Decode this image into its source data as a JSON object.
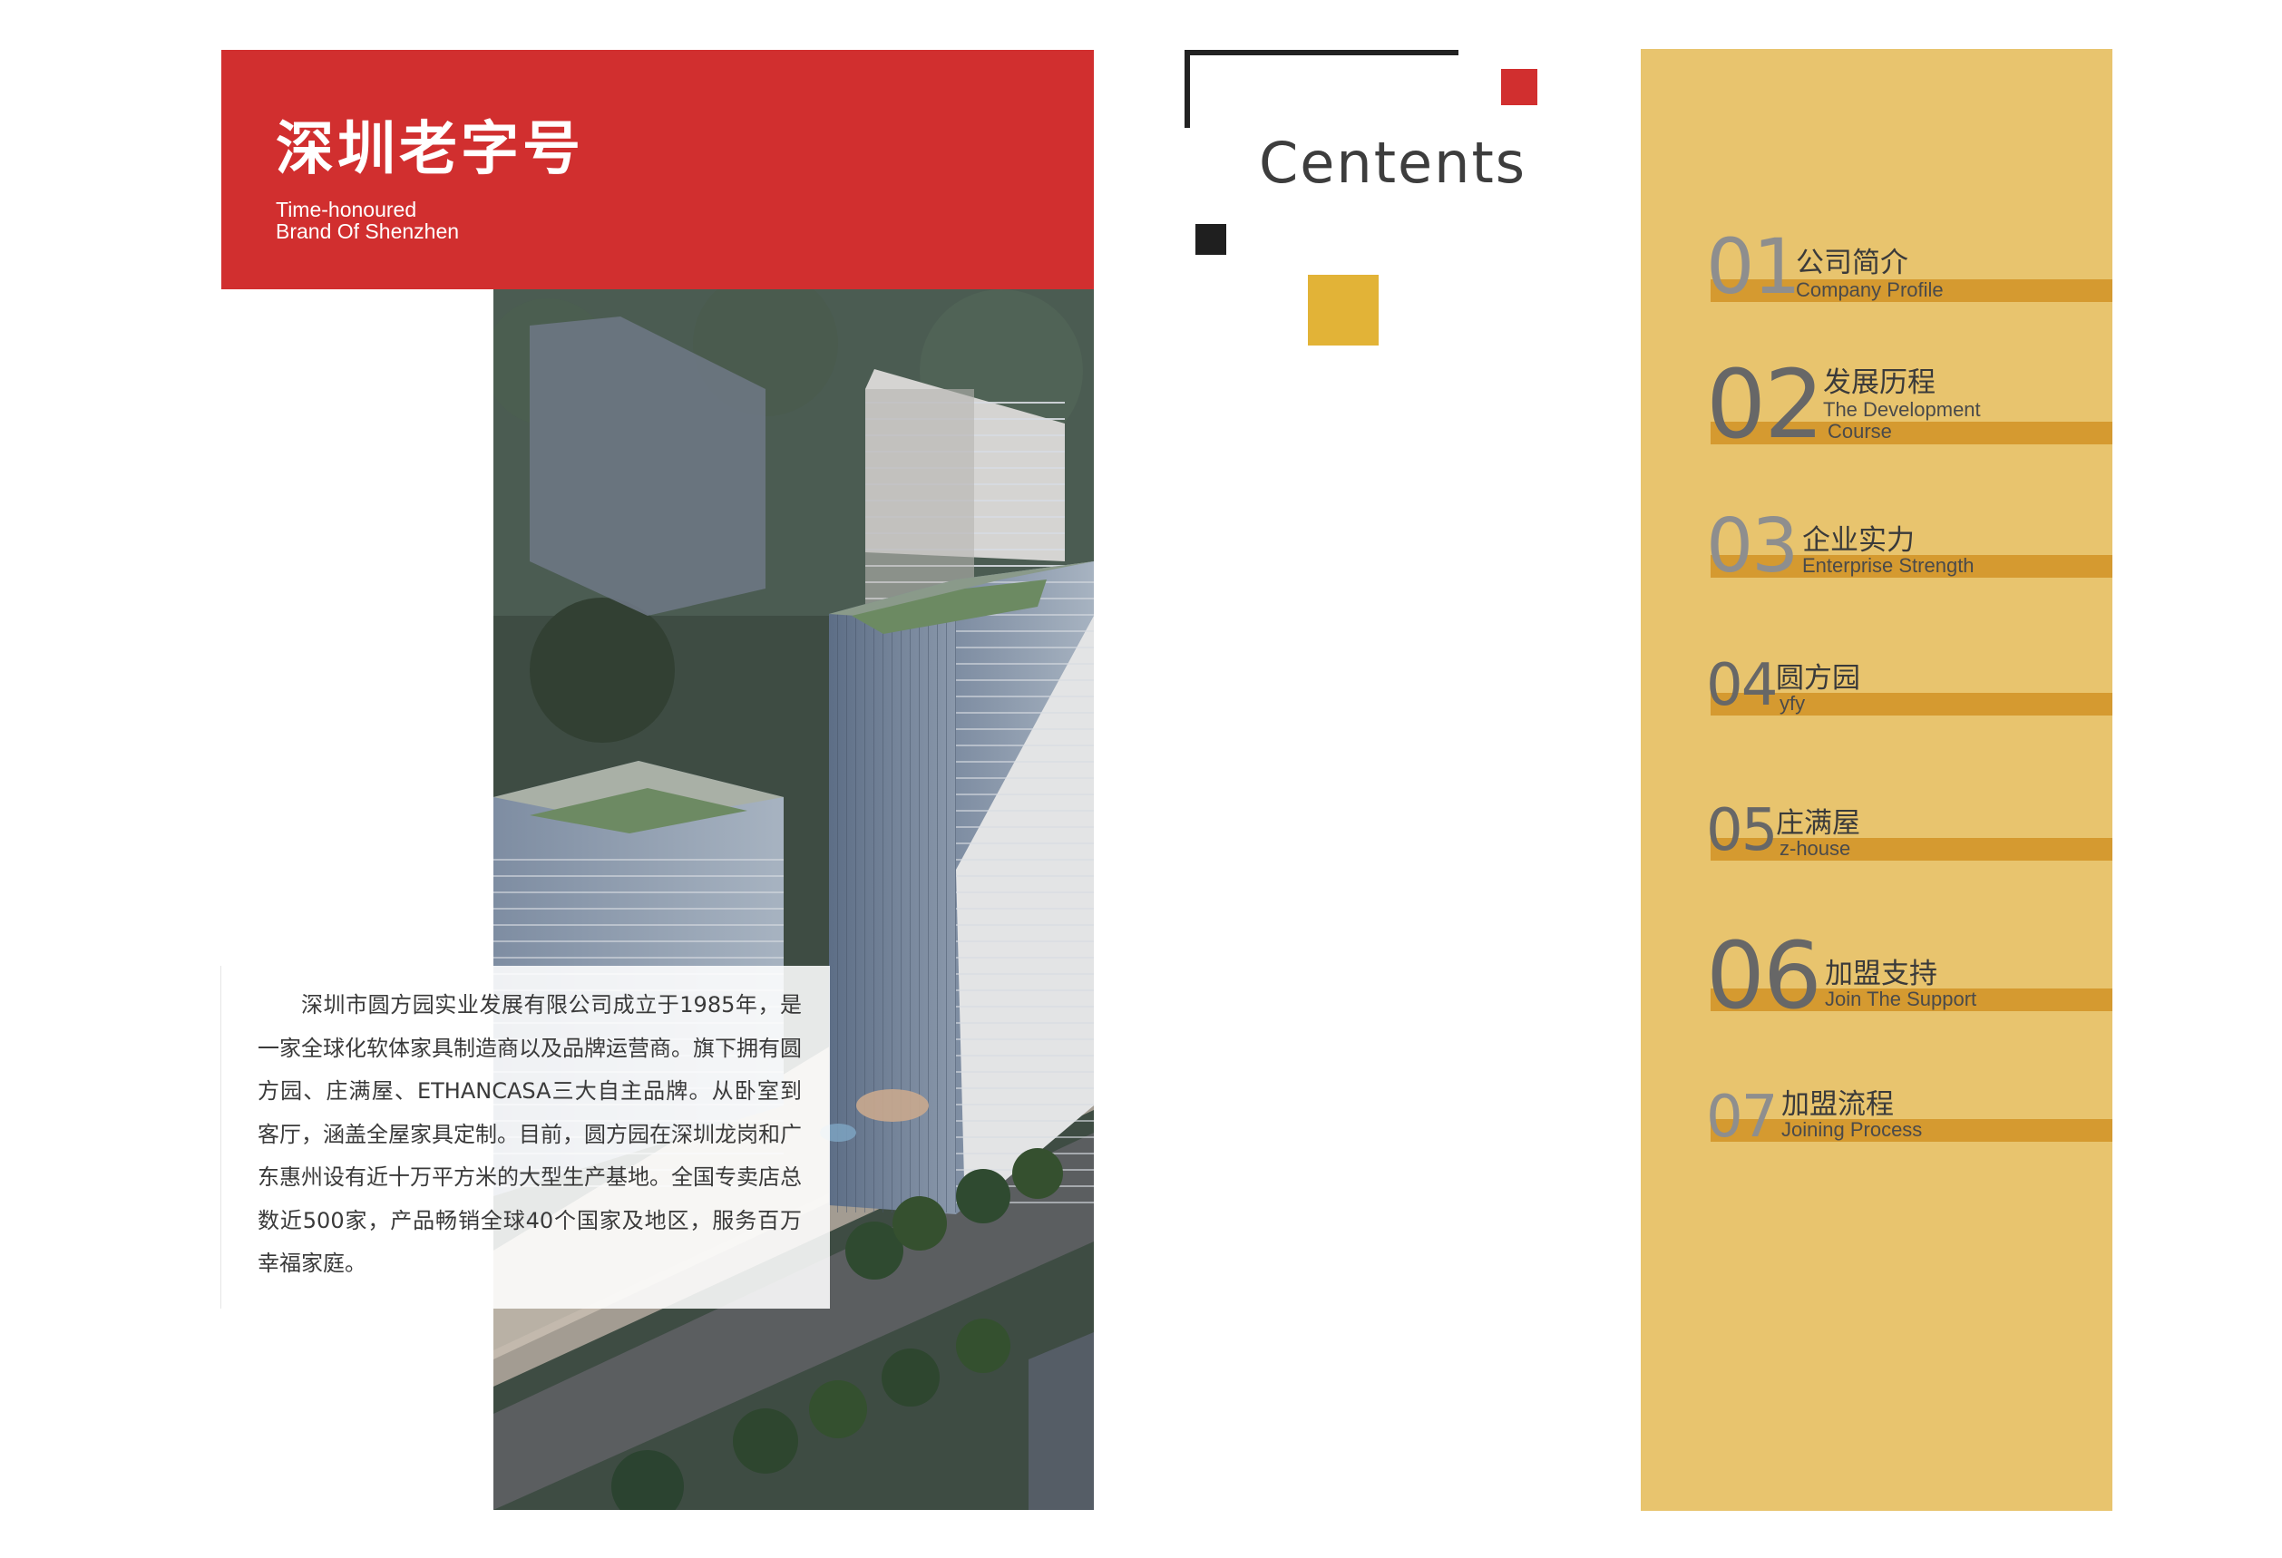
{
  "banner": {
    "title": "深圳老字号",
    "subtitle_line1": "Time-honoured",
    "subtitle_line2": "Brand Of Shenzhen"
  },
  "intro": {
    "text": "深圳市圆方园实业发展有限公司成立于1985年，是一家全球化软体家具制造商以及品牌运营商。旗下拥有圆方园、庄满屋、ETHANCASA三大自主品牌。从卧室到客厅，涵盖全屋家具定制。目前，圆方园在深圳龙岗和广东惠州设有近十万平方米的大型生产基地。全国专卖店总数近500家，产品畅销全球40个国家及地区，服务百万幸福家庭。"
  },
  "contents": {
    "title": "Centents"
  },
  "toc": {
    "items": [
      {
        "num": "01",
        "cn": "公司简介",
        "en": "Company Profile"
      },
      {
        "num": "02",
        "cn": "发展历程",
        "en": "The Development",
        "en2": "Course"
      },
      {
        "num": "03",
        "cn": "企业实力",
        "en": "Enterprise Strength"
      },
      {
        "num": "04",
        "cn": "圆方园",
        "en": "yfy"
      },
      {
        "num": "05",
        "cn": "庄满屋",
        "en": "z-house"
      },
      {
        "num": "06",
        "cn": "加盟支持",
        "en": "Join The Support"
      },
      {
        "num": "07",
        "cn": "加盟流程",
        "en": "Joining Process"
      }
    ]
  },
  "colors": {
    "brand_red": "#d12f2f",
    "toc_background": "#e8c46e",
    "toc_bar": "#d59a30",
    "accent_yellow": "#e2b337",
    "dark": "#1f1f1f"
  }
}
